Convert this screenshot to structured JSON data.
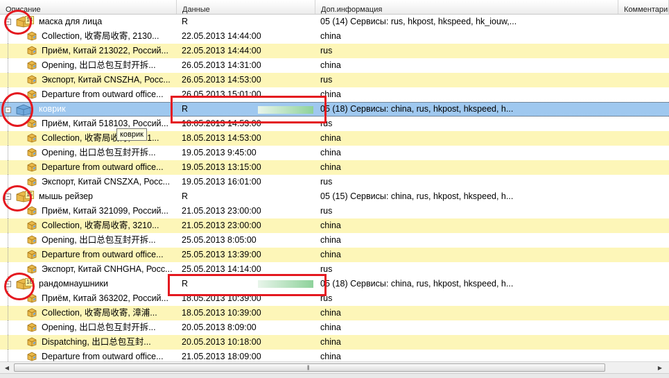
{
  "columns": [
    "Описание",
    "Данные",
    "Доп.информация",
    "Комментарий"
  ],
  "rows": [
    {
      "type": "group",
      "desc": "маска для лица",
      "data": "R",
      "info": "05 (14) Сервисы: rus, hkpost, hkspeed, hk_iouw,...",
      "count": "14"
    },
    {
      "type": "child",
      "desc": "Collection, 收寄局收寄, 2130...",
      "data": "22.05.2013 14:44:00",
      "info": "china"
    },
    {
      "type": "child",
      "desc": "Приём, Китай 213022, Россий...",
      "data": "22.05.2013 14:44:00",
      "info": "rus"
    },
    {
      "type": "child",
      "desc": "Opening, 出口总包互封开拆...",
      "data": "26.05.2013 14:31:00",
      "info": "china"
    },
    {
      "type": "child",
      "desc": "Экспорт, Китай CNSZHA, Росс...",
      "data": "26.05.2013 14:53:00",
      "info": "rus"
    },
    {
      "type": "child",
      "desc": "Departure from outward office...",
      "data": "26.05.2013 15:01:00",
      "info": "china"
    },
    {
      "type": "group",
      "desc": "коврик",
      "data": "R",
      "info": "05 (18) Сервисы: china, rus, hkpost, hkspeed, h...",
      "selected": true
    },
    {
      "type": "child",
      "desc": "Приём, Китай 518103, Россий...",
      "data": "18.05.2013 14:53:00",
      "info": "rus"
    },
    {
      "type": "child",
      "desc": "Collection, 收寄局收寄, 5181...",
      "data": "18.05.2013 14:53:00",
      "info": "china"
    },
    {
      "type": "child",
      "desc": "Opening, 出口总包互封开拆...",
      "data": "19.05.2013 9:45:00",
      "info": "china"
    },
    {
      "type": "child",
      "desc": "Departure from outward office...",
      "data": "19.05.2013 13:15:00",
      "info": "china"
    },
    {
      "type": "child",
      "desc": "Экспорт, Китай CNSZXA, Росс...",
      "data": "19.05.2013 16:01:00",
      "info": "rus"
    },
    {
      "type": "group",
      "desc": "мышь рейзер",
      "data": "R",
      "info": "05 (15) Сервисы: china, rus, hkpost, hkspeed, h...",
      "count": "15"
    },
    {
      "type": "child",
      "desc": "Приём, Китай 321099, Россий...",
      "data": "21.05.2013 23:00:00",
      "info": "rus"
    },
    {
      "type": "child",
      "desc": "Collection, 收寄局收寄, 3210...",
      "data": "21.05.2013 23:00:00",
      "info": "china"
    },
    {
      "type": "child",
      "desc": "Opening, 出口总包互封开拆...",
      "data": "25.05.2013 8:05:00",
      "info": "china"
    },
    {
      "type": "child",
      "desc": "Departure from outward office...",
      "data": "25.05.2013 13:39:00",
      "info": "china"
    },
    {
      "type": "child",
      "desc": "Экспорт, Китай CNHGHA, Росс...",
      "data": "25.05.2013 14:14:00",
      "info": "rus"
    },
    {
      "type": "group",
      "desc": "рандомнаушники",
      "data": "R",
      "info": "05 (18) Сервисы: china, rus, hkpost, hkspeed, h...",
      "count": "18"
    },
    {
      "type": "child",
      "desc": "Приём, Китай 363202, Россий...",
      "data": "18.05.2013 10:39:00",
      "info": "rus"
    },
    {
      "type": "child",
      "desc": "Collection, 收寄局收寄, 漳浦...",
      "data": "18.05.2013 10:39:00",
      "info": "china"
    },
    {
      "type": "child",
      "desc": "Opening, 出口总包互封开拆...",
      "data": "20.05.2013 8:09:00",
      "info": "china"
    },
    {
      "type": "child",
      "desc": "Dispatching, 出口总包互封...",
      "data": "20.05.2013 10:18:00",
      "info": "china"
    },
    {
      "type": "child",
      "desc": "Departure from outward office...",
      "data": "21.05.2013 18:09:00",
      "info": "china"
    }
  ],
  "tooltip": "коврик",
  "colors": {
    "alt_row": "#fdf6b8",
    "selected_row": "#9fc8ef",
    "annotation": "#e4181f"
  }
}
